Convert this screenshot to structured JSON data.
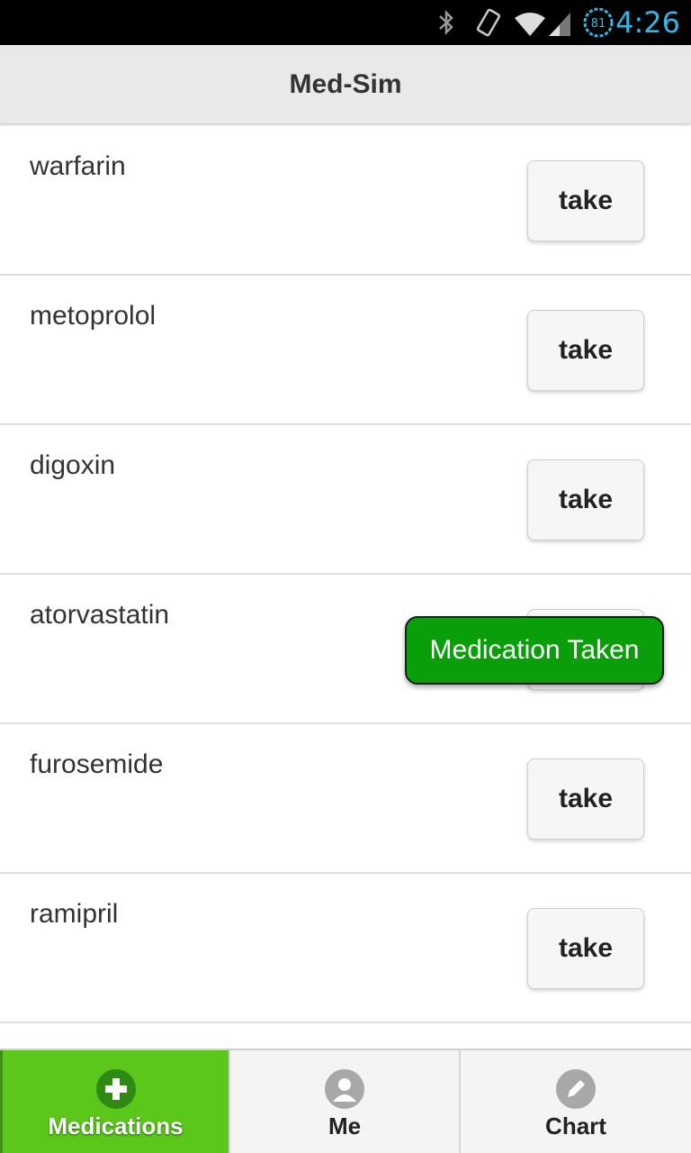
{
  "status_bar": {
    "time": "4:26",
    "battery": "81"
  },
  "header": {
    "title": "Med-Sim"
  },
  "medications": [
    {
      "name": "warfarin",
      "button": "take"
    },
    {
      "name": "metoprolol",
      "button": "take"
    },
    {
      "name": "digoxin",
      "button": "take"
    },
    {
      "name": "atorvastatin",
      "button": "take"
    },
    {
      "name": "furosemide",
      "button": "take"
    },
    {
      "name": "ramipril",
      "button": "take"
    }
  ],
  "toast": {
    "text": "Medication Taken"
  },
  "tabs": [
    {
      "label": "Medications",
      "icon": "plus-circle-icon",
      "active": true
    },
    {
      "label": "Me",
      "icon": "person-icon",
      "active": false
    },
    {
      "label": "Chart",
      "icon": "pencil-icon",
      "active": false
    }
  ],
  "colors": {
    "active_tab": "#5ac71a",
    "toast_bg": "#0a9e0a",
    "status_accent": "#33b5e5"
  }
}
